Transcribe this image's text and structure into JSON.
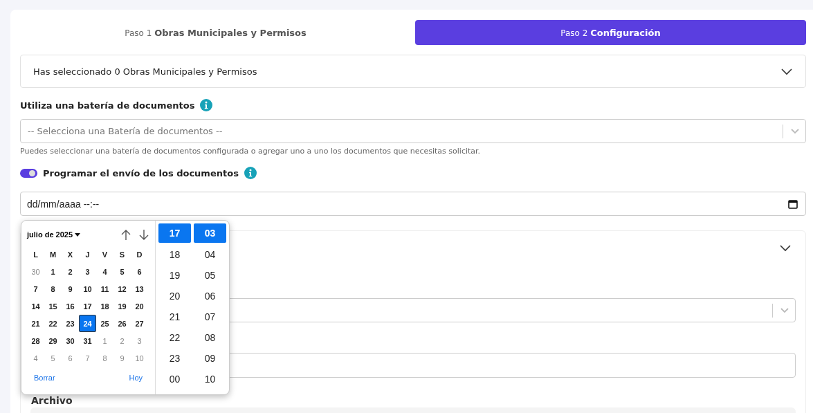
{
  "steps": [
    {
      "prefix": "Paso 1",
      "label": "Obras Municipales y Permisos",
      "selected": false
    },
    {
      "prefix": "Paso 2",
      "label": "Configuración",
      "selected": true
    }
  ],
  "summary": {
    "text": "Has seleccionado 0 Obras Municipales y Permisos",
    "expanded": false
  },
  "battery": {
    "label": "Utiliza una batería de documentos",
    "placeholder": "-- Selecciona una Batería de documentos --",
    "help": "Puedes seleccionar una batería de documentos configurada o agregar uno a uno los documentos que necesitas solicitar."
  },
  "schedule": {
    "label": "Programar el envío de los documentos",
    "on": true,
    "placeholder": "dd/mm/aaaa --:--"
  },
  "lower_section": {
    "file_label": "Archivo"
  },
  "date_picker": {
    "month": "julio de 2025",
    "weekdays": [
      "L",
      "M",
      "X",
      "J",
      "V",
      "S",
      "D"
    ],
    "days": [
      {
        "text": "30",
        "kind": "other",
        "selected": false
      },
      {
        "text": "1",
        "kind": "current",
        "selected": false
      },
      {
        "text": "2",
        "kind": "current",
        "selected": false
      },
      {
        "text": "3",
        "kind": "current",
        "selected": false
      },
      {
        "text": "4",
        "kind": "current",
        "selected": false
      },
      {
        "text": "5",
        "kind": "current",
        "selected": false
      },
      {
        "text": "6",
        "kind": "current",
        "selected": false
      },
      {
        "text": "7",
        "kind": "current",
        "selected": false
      },
      {
        "text": "8",
        "kind": "current",
        "selected": false
      },
      {
        "text": "9",
        "kind": "current",
        "selected": false
      },
      {
        "text": "10",
        "kind": "current",
        "selected": false
      },
      {
        "text": "11",
        "kind": "current",
        "selected": false
      },
      {
        "text": "12",
        "kind": "current",
        "selected": false
      },
      {
        "text": "13",
        "kind": "current",
        "selected": false
      },
      {
        "text": "14",
        "kind": "current",
        "selected": false
      },
      {
        "text": "15",
        "kind": "current",
        "selected": false
      },
      {
        "text": "16",
        "kind": "current",
        "selected": false
      },
      {
        "text": "17",
        "kind": "current",
        "selected": false
      },
      {
        "text": "18",
        "kind": "current",
        "selected": false
      },
      {
        "text": "19",
        "kind": "current",
        "selected": false
      },
      {
        "text": "20",
        "kind": "current",
        "selected": false
      },
      {
        "text": "21",
        "kind": "current",
        "selected": false
      },
      {
        "text": "22",
        "kind": "current",
        "selected": false
      },
      {
        "text": "23",
        "kind": "current",
        "selected": false
      },
      {
        "text": "24",
        "kind": "current",
        "selected": true
      },
      {
        "text": "25",
        "kind": "current",
        "selected": false
      },
      {
        "text": "26",
        "kind": "current",
        "selected": false
      },
      {
        "text": "27",
        "kind": "current",
        "selected": false
      },
      {
        "text": "28",
        "kind": "current",
        "selected": false
      },
      {
        "text": "29",
        "kind": "current",
        "selected": false
      },
      {
        "text": "30",
        "kind": "current",
        "selected": false
      },
      {
        "text": "31",
        "kind": "current",
        "selected": false
      },
      {
        "text": "1",
        "kind": "other",
        "selected": false
      },
      {
        "text": "2",
        "kind": "other",
        "selected": false
      },
      {
        "text": "3",
        "kind": "other",
        "selected": false
      },
      {
        "text": "4",
        "kind": "other",
        "selected": false
      },
      {
        "text": "5",
        "kind": "other",
        "selected": false
      },
      {
        "text": "6",
        "kind": "other",
        "selected": false
      },
      {
        "text": "7",
        "kind": "other",
        "selected": false
      },
      {
        "text": "8",
        "kind": "other",
        "selected": false
      },
      {
        "text": "9",
        "kind": "other",
        "selected": false
      },
      {
        "text": "10",
        "kind": "other",
        "selected": false
      }
    ],
    "clear": "Borrar",
    "today": "Hoy",
    "hours": [
      {
        "text": "17",
        "selected": true
      },
      {
        "text": "18",
        "selected": false
      },
      {
        "text": "19",
        "selected": false
      },
      {
        "text": "20",
        "selected": false
      },
      {
        "text": "21",
        "selected": false
      },
      {
        "text": "22",
        "selected": false
      },
      {
        "text": "23",
        "selected": false
      },
      {
        "text": "00",
        "selected": false
      }
    ],
    "minutes": [
      {
        "text": "03",
        "selected": true
      },
      {
        "text": "04",
        "selected": false
      },
      {
        "text": "05",
        "selected": false
      },
      {
        "text": "06",
        "selected": false
      },
      {
        "text": "07",
        "selected": false
      },
      {
        "text": "08",
        "selected": false
      },
      {
        "text": "09",
        "selected": false
      },
      {
        "text": "10",
        "selected": false
      }
    ]
  }
}
